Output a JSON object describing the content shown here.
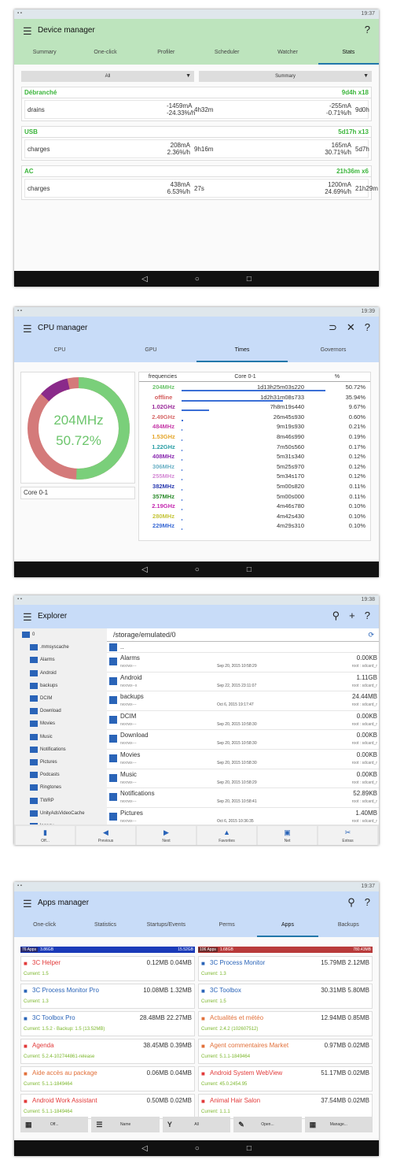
{
  "s1": {
    "time": "19:37",
    "title": "Device manager",
    "help": "?",
    "tabs": [
      "Summary",
      "One-click",
      "Profiler",
      "Scheduler",
      "Watcher",
      "Stats"
    ],
    "dd1": "All",
    "dd2": "Summary",
    "cards": [
      {
        "name": "Débranché",
        "time": "9d4h x18",
        "label": "drains",
        "v1a": "-1459mA",
        "v1b": "-24.33%/h",
        "t1": "4h32m",
        "v2a": "-255mA",
        "v2b": "-0.71%/h",
        "t2": "9d0h"
      },
      {
        "name": "USB",
        "time": "5d17h x13",
        "label": "charges",
        "v1a": "208mA",
        "v1b": "2.36%/h",
        "t1": "9h16m",
        "v2a": "165mA",
        "v2b": "30.71%/h",
        "t2": "5d7h"
      },
      {
        "name": "AC",
        "time": "21h36m x6",
        "label": "charges",
        "v1a": "438mA",
        "v1b": "6.53%/h",
        "t1": "27s",
        "v2a": "1200mA",
        "v2b": "24.69%/h",
        "t2": "21h29m"
      }
    ]
  },
  "s2": {
    "time": "19:39",
    "title": "CPU manager",
    "tabs": [
      "CPU",
      "GPU",
      "Times",
      "Governors"
    ],
    "donut_freq": "204MHz",
    "donut_pct": "50.72%",
    "core": "Core 0-1",
    "head": [
      "frequencies",
      "Core 0-1",
      "%"
    ],
    "rows": [
      {
        "f": "204MHz",
        "t": "1d13h25m03s220",
        "p": "50.72%",
        "c": "#6cc56c",
        "bar": 0.5072
      },
      {
        "f": "offline",
        "t": "1d2h31m08s733",
        "p": "35.94%",
        "c": "#d35b5b",
        "bar": 0.3594
      },
      {
        "f": "1.02GHz",
        "t": "7h8m19s440",
        "p": "9.67%",
        "c": "#9a2a9a",
        "bar": 0.0967
      },
      {
        "f": "2.49GHz",
        "t": "26m45s930",
        "p": "0.60%",
        "c": "#d86d6d",
        "bar": 0.006
      },
      {
        "f": "484MHz",
        "t": "9m19s930",
        "p": "0.21%",
        "c": "#c63aa8",
        "bar": 0.0021
      },
      {
        "f": "1.53GHz",
        "t": "8m46s990",
        "p": "0.19%",
        "c": "#e5a52a",
        "bar": 0.0019
      },
      {
        "f": "1.22GHz",
        "t": "7m50s560",
        "p": "0.17%",
        "c": "#2a9ea5",
        "bar": 0.0017
      },
      {
        "f": "408MHz",
        "t": "5m31s340",
        "p": "0.12%",
        "c": "#8a2ab0",
        "bar": 0.0012
      },
      {
        "f": "306MHz",
        "t": "5m25s970",
        "p": "0.12%",
        "c": "#6ab0c5",
        "bar": 0.0012
      },
      {
        "f": "255MHz",
        "t": "5m34s170",
        "p": "0.12%",
        "c": "#d58ad5",
        "bar": 0.0012
      },
      {
        "f": "382MHz",
        "t": "5m00s820",
        "p": "0.11%",
        "c": "#2a3ab0",
        "bar": 0.0011
      },
      {
        "f": "357MHz",
        "t": "5m00s000",
        "p": "0.11%",
        "c": "#2a8a2a",
        "bar": 0.0011
      },
      {
        "f": "2.19GHz",
        "t": "4m46s780",
        "p": "0.10%",
        "c": "#c52ab0",
        "bar": 0.001
      },
      {
        "f": "280MHz",
        "t": "4m42s430",
        "p": "0.10%",
        "c": "#c5c53a",
        "bar": 0.001
      },
      {
        "f": "229MHz",
        "t": "4m29s310",
        "p": "0.10%",
        "c": "#3a6ad5",
        "bar": 0.001
      }
    ]
  },
  "s3": {
    "time": "19:38",
    "title": "Explorer",
    "path": "/storage/emulated/0",
    "tree": [
      "0",
      ".mmsyscache",
      "Alarms",
      "Android",
      "backups",
      "DCIM",
      "Download",
      "Movies",
      "Music",
      "Notifications",
      "Pictures",
      "Podcasts",
      "Ringtones",
      "TWRP",
      "UnityAdsVideoCache",
      "legacy"
    ],
    "up": "..",
    "files": [
      {
        "n": "Alarms",
        "pm": "rwxrwx---",
        "d": "Sep 20, 2015 10:58:29",
        "sz": "0.00KB",
        "ow": "root : sdcard_r"
      },
      {
        "n": "Android",
        "pm": "rwxrwx--x",
        "d": "Sep 22, 2015 23:11:07",
        "sz": "1.11GB",
        "ow": "root : sdcard_r"
      },
      {
        "n": "backups",
        "pm": "rwxrwx---",
        "d": "Oct 6, 2015 19:17:47",
        "sz": "24.44MB",
        "ow": "root : sdcard_r"
      },
      {
        "n": "DCIM",
        "pm": "rwxrwx---",
        "d": "Sep 20, 2015 10:58:30",
        "sz": "0.00KB",
        "ow": "root : sdcard_r"
      },
      {
        "n": "Download",
        "pm": "rwxrwx---",
        "d": "Sep 20, 2015 10:58:30",
        "sz": "0.00KB",
        "ow": "root : sdcard_r"
      },
      {
        "n": "Movies",
        "pm": "rwxrwx---",
        "d": "Sep 20, 2015 10:58:30",
        "sz": "0.00KB",
        "ow": "root : sdcard_r"
      },
      {
        "n": "Music",
        "pm": "rwxrwx---",
        "d": "Sep 20, 2015 10:58:29",
        "sz": "0.00KB",
        "ow": "root : sdcard_r"
      },
      {
        "n": "Notifications",
        "pm": "rwxrwx---",
        "d": "Sep 20, 2015 10:58:41",
        "sz": "52.89KB",
        "ow": "root : sdcard_r"
      },
      {
        "n": "Pictures",
        "pm": "rwxrwx---",
        "d": "Oct 6, 2015 10:36:35",
        "sz": "1.40MB",
        "ow": "root : sdcard_r"
      }
    ],
    "buttons": [
      "Off...",
      "Previous",
      "Next",
      "Favorites",
      "Net",
      "Extras"
    ]
  },
  "s4": {
    "time": "19:37",
    "title": "Apps manager",
    "tabs": [
      "One-click",
      "Statistics",
      "Startups/Events",
      "Perms",
      "Apps",
      "Backups"
    ],
    "bar1": {
      "count": "76 Apps",
      "used": "3.86GB",
      "total": "15.52GB"
    },
    "bar2": {
      "count": "106 Apps",
      "used": "1.68GB",
      "total": "780.43MB"
    },
    "apps": [
      {
        "n": "3C Helper",
        "m": "0.12MB  0.04MB",
        "c": "Current: 1.5",
        "col": "#e23a3a"
      },
      {
        "n": "3C Process Monitor",
        "m": "15.79MB  2.12MB",
        "c": "Current: 1.3",
        "col": "#2a64b8"
      },
      {
        "n": "3C Process Monitor Pro",
        "m": "10.08MB  1.32MB",
        "c": "Current: 1.3",
        "col": "#2a64b8"
      },
      {
        "n": "3C Toolbox",
        "m": "30.31MB  5.80MB",
        "c": "Current: 1.5",
        "col": "#2a64b8"
      },
      {
        "n": "3C Toolbox Pro",
        "m": "28.48MB  22.27MB",
        "c": "Current: 1.5.2 - Backup: 1.5 (13.52MB)",
        "col": "#2a64b8"
      },
      {
        "n": "Actualités et météo",
        "m": "12.94MB  0.85MB",
        "c": "Current: 2.4.2 (102607512)",
        "col": "#e2703a"
      },
      {
        "n": "Agenda",
        "m": "38.45MB  0.39MB",
        "c": "Current: 5.2.4-102744861-release",
        "col": "#e23a3a"
      },
      {
        "n": "Agent commentaires Market",
        "m": "0.97MB  0.02MB",
        "c": "Current: 5.1.1-1849464",
        "col": "#e2703a"
      },
      {
        "n": "Aide accès au package",
        "m": "0.06MB  0.04MB",
        "c": "Current: 5.1.1-1849464",
        "col": "#e2703a"
      },
      {
        "n": "Android System WebView",
        "m": "51.17MB  0.02MB",
        "c": "Current: 45.0.2454.95",
        "col": "#e23a3a"
      },
      {
        "n": "Android Work Assistant",
        "m": "0.50MB  0.02MB",
        "c": "Current: 5.1.1-1849464",
        "col": "#e23a3a"
      },
      {
        "n": "Animal Hair Salon",
        "m": "37.54MB  0.02MB",
        "c": "Current: 1.1.1",
        "col": "#e23a3a"
      }
    ],
    "buttons": [
      "Off...",
      "Name",
      "All",
      "Open...",
      "Manage..."
    ]
  }
}
